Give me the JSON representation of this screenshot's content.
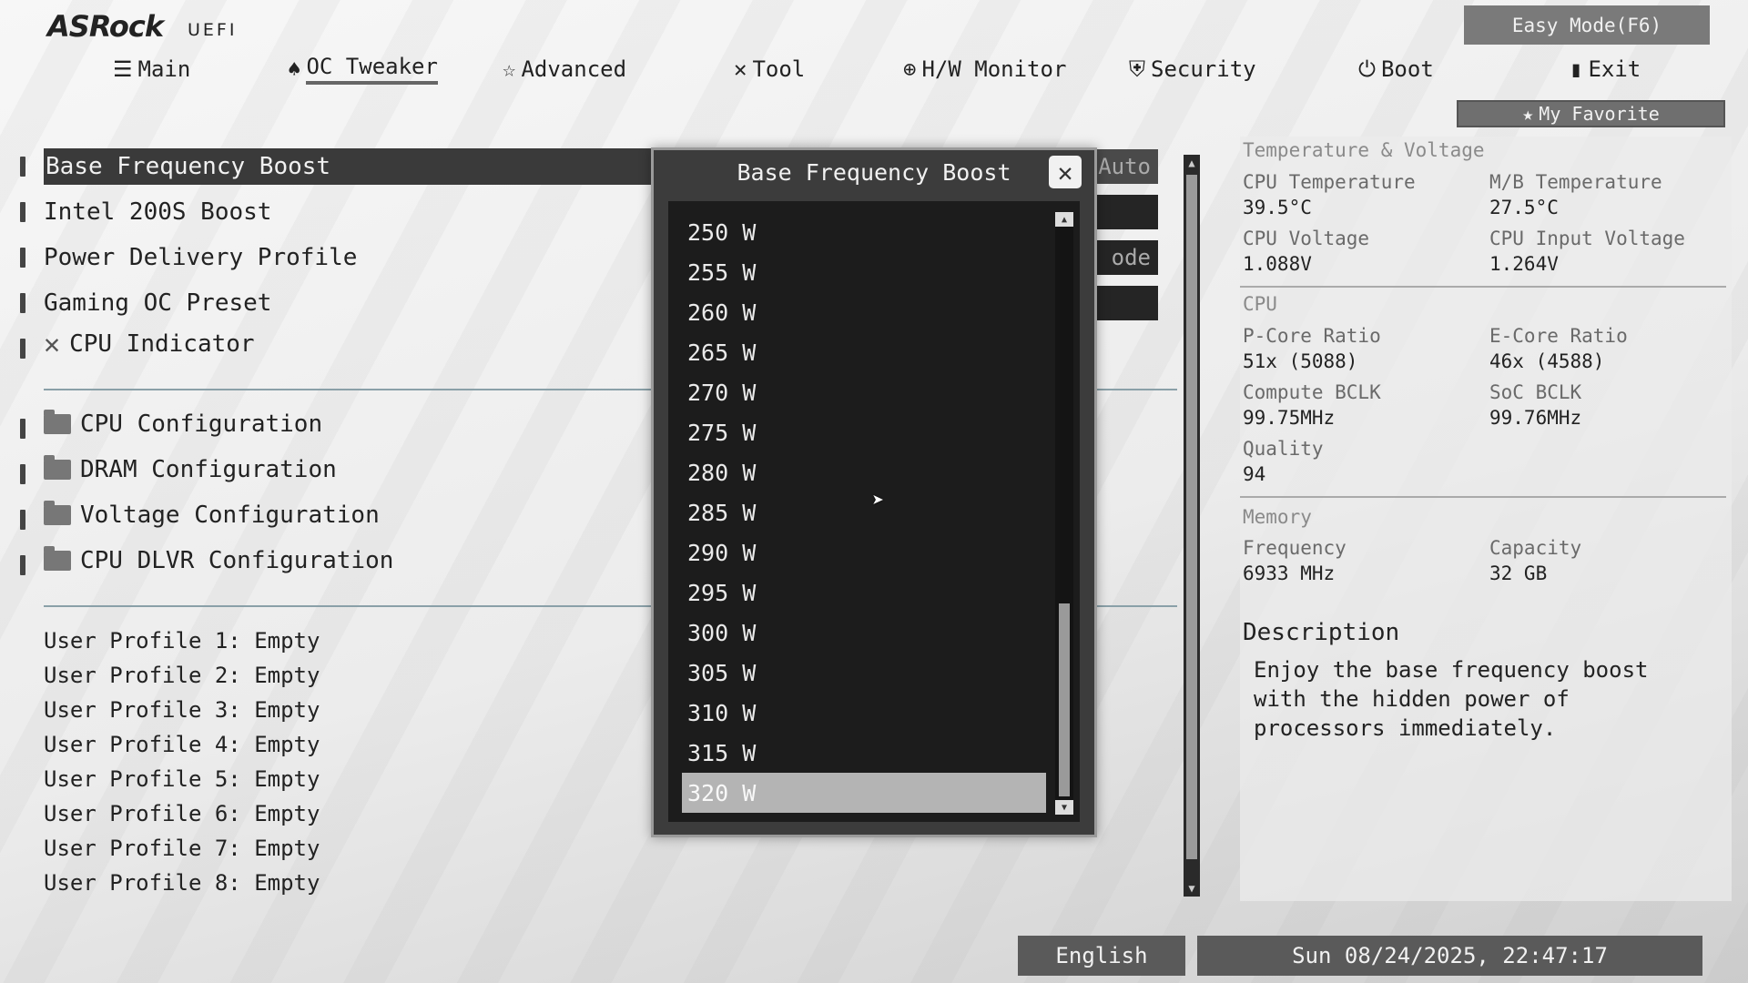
{
  "brand": {
    "logo": "ASRock",
    "sub": "UEFI"
  },
  "header": {
    "easy_mode": "Easy Mode(F6)",
    "my_favorite": "My Favorite"
  },
  "nav": [
    {
      "label": "Main",
      "icon": "list-icon"
    },
    {
      "label": "OC Tweaker",
      "icon": "rocket-icon",
      "active": true
    },
    {
      "label": "Advanced",
      "icon": "star-icon"
    },
    {
      "label": "Tool",
      "icon": "tool-icon"
    },
    {
      "label": "H/W Monitor",
      "icon": "monitor-icon"
    },
    {
      "label": "Security",
      "icon": "shield-icon"
    },
    {
      "label": "Boot",
      "icon": "power-icon"
    },
    {
      "label": "Exit",
      "icon": "exit-icon"
    }
  ],
  "menu": {
    "items": [
      "Base Frequency Boost",
      "Intel 200S Boost",
      "Power Delivery Profile",
      "Gaming OC Preset",
      "CPU Indicator"
    ],
    "folders": [
      "CPU Configuration",
      "DRAM Configuration",
      "Voltage Configuration",
      "CPU DLVR Configuration"
    ],
    "profiles": [
      "User Profile 1: Empty",
      "User Profile 2: Empty",
      "User Profile 3: Empty",
      "User Profile 4: Empty",
      "User Profile 5: Empty",
      "User Profile 6: Empty",
      "User Profile 7: Empty",
      "User Profile 8: Empty"
    ],
    "partial_values": [
      "Auto",
      "",
      "ode",
      ""
    ]
  },
  "panel": {
    "temp_section": "Temperature & Voltage",
    "cpu_temp_label": "CPU Temperature",
    "cpu_temp": "39.5°C",
    "mb_temp_label": "M/B Temperature",
    "mb_temp": "27.5°C",
    "cpu_volt_label": "CPU Voltage",
    "cpu_volt": "1.088V",
    "cpu_in_volt_label": "CPU Input Voltage",
    "cpu_in_volt": "1.264V",
    "cpu_section": "CPU",
    "pcore_label": "P-Core Ratio",
    "pcore": "51x (5088)",
    "ecore_label": "E-Core Ratio",
    "ecore": "46x (4588)",
    "cbclk_label": "Compute BCLK",
    "cbclk": "99.75MHz",
    "socbclk_label": "SoC BCLK",
    "socbclk": "99.76MHz",
    "quality_label": "Quality",
    "quality": "94",
    "mem_section": "Memory",
    "freq_label": "Frequency",
    "freq": "6933 MHz",
    "cap_label": "Capacity",
    "cap": "32 GB",
    "desc_title": "Description",
    "desc_text": "Enjoy the base frequency boost with the hidden power of processors immediately."
  },
  "footer": {
    "language": "English",
    "datetime": "Sun 08/24/2025, 22:47:17"
  },
  "modal": {
    "title": "Base Frequency Boost",
    "options": [
      "250 W",
      "255 W",
      "260 W",
      "265 W",
      "270 W",
      "275 W",
      "280 W",
      "285 W",
      "290 W",
      "295 W",
      "300 W",
      "305 W",
      "310 W",
      "315 W",
      "320 W"
    ],
    "selected_index": 14
  }
}
